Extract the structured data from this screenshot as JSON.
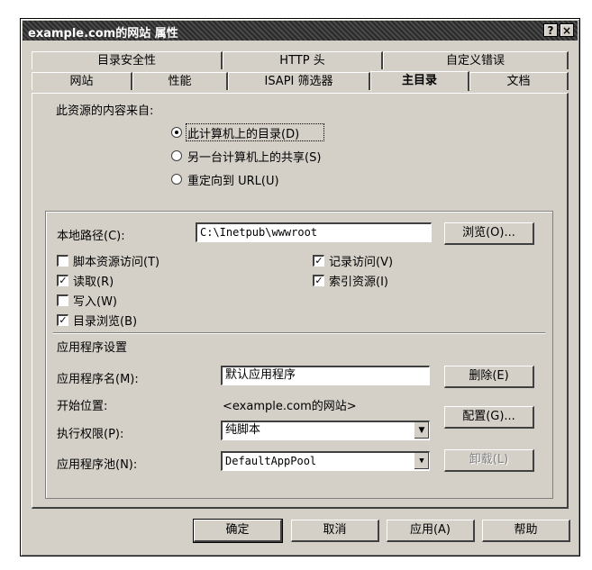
{
  "window": {
    "title": "example.com的网站 属性",
    "help_glyph": "?",
    "close_glyph": "×"
  },
  "tabs_back": [
    "目录安全性",
    "HTTP 头",
    "自定义错误"
  ],
  "tabs_front": [
    "网站",
    "性能",
    "ISAPI 筛选器",
    "主目录",
    "文档"
  ],
  "active_tab": "主目录",
  "source": {
    "heading": "此资源的内容来自:",
    "options": [
      {
        "label": "此计算机上的目录(D)",
        "selected": true
      },
      {
        "label": "另一台计算机上的共享(S)",
        "selected": false
      },
      {
        "label": "重定向到 URL(U)",
        "selected": false
      }
    ]
  },
  "local_path": {
    "label": "本地路径(C):",
    "value": "C:\\Inetpub\\wwwroot",
    "browse_label": "浏览(O)..."
  },
  "permissions_left": [
    {
      "label": "脚本资源访问(T)",
      "checked": false
    },
    {
      "label": "读取(R)",
      "checked": true
    },
    {
      "label": "写入(W)",
      "checked": false
    },
    {
      "label": "目录浏览(B)",
      "checked": true
    }
  ],
  "permissions_right": [
    {
      "label": "记录访问(V)",
      "checked": true
    },
    {
      "label": "索引资源(I)",
      "checked": true
    }
  ],
  "app_settings": {
    "heading": "应用程序设置",
    "app_name_label": "应用程序名(M):",
    "app_name_value": "默认应用程序",
    "remove_label": "删除(E)",
    "start_point_label": "开始位置:",
    "start_point_value": "<example.com的网站>",
    "config_label": "配置(G)...",
    "exec_perm_label": "执行权限(P):",
    "exec_perm_value": "纯脚本",
    "app_pool_label": "应用程序池(N):",
    "app_pool_value": "DefaultAppPool",
    "unload_label": "卸载(L)"
  },
  "buttons": {
    "ok": "确定",
    "cancel": "取消",
    "apply": "应用(A)",
    "help": "帮助"
  },
  "check_glyph": "✓",
  "dropdown_glyph": "▼"
}
